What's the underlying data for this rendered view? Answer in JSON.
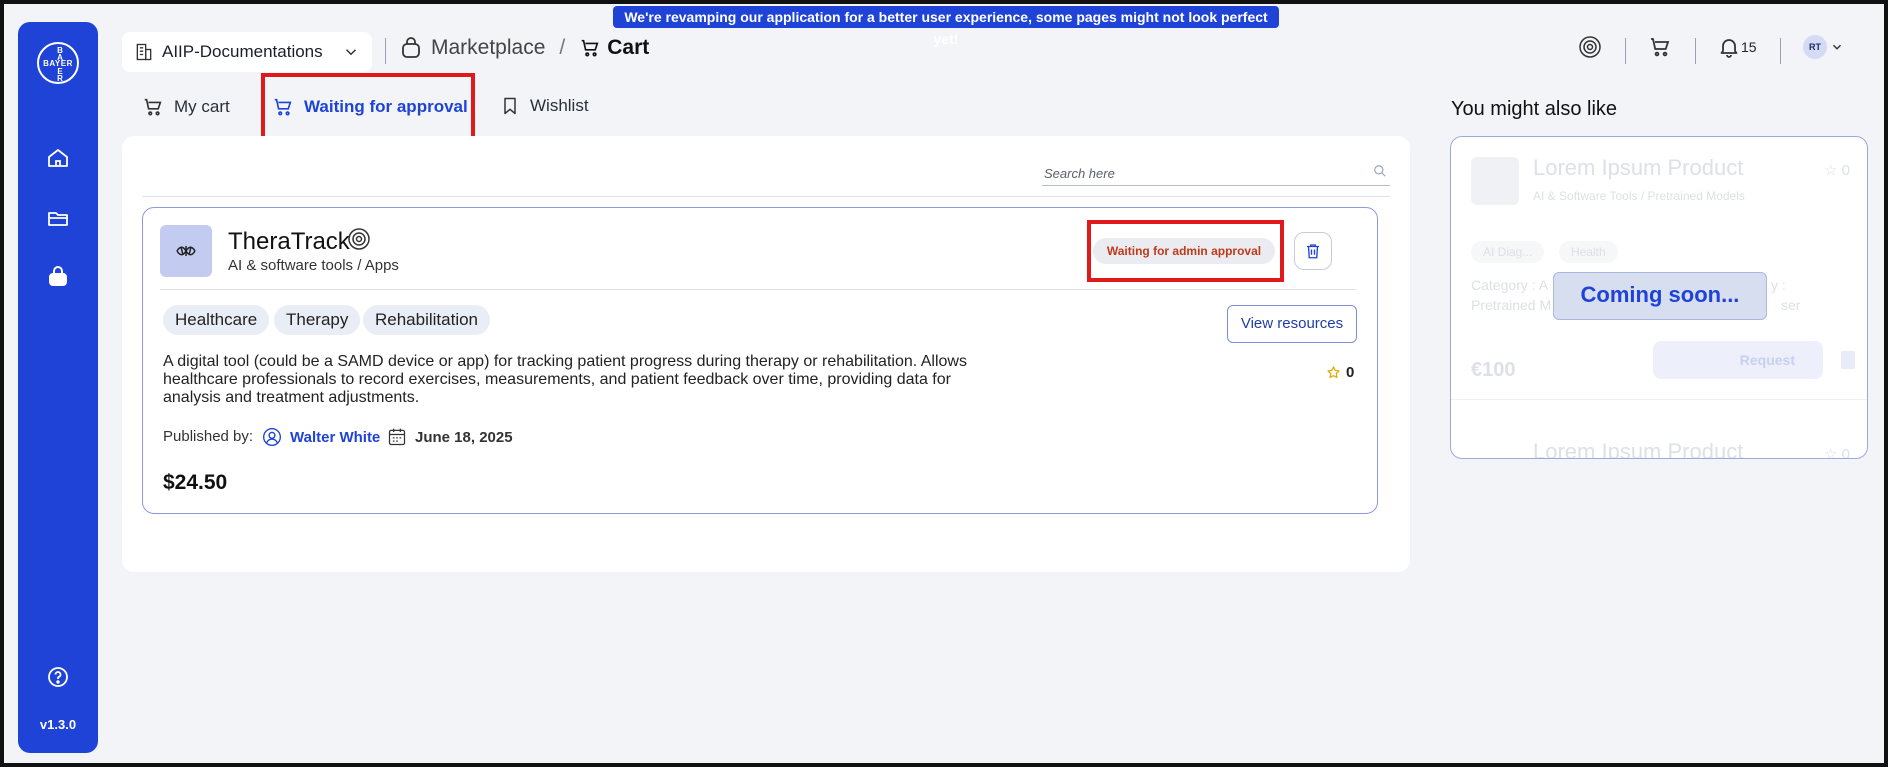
{
  "banner": {
    "text": "We're revamping our application for a better user experience, some pages might not look perfect yet!"
  },
  "sidebar": {
    "logo_horizontal": "BAYER",
    "logo_vertical": [
      "B",
      "A",
      "",
      "E",
      "R"
    ],
    "items": [
      {
        "icon": "home-icon"
      },
      {
        "icon": "folder-icon"
      },
      {
        "icon": "marketplace-bag-icon"
      },
      {
        "icon": "help-icon"
      }
    ],
    "version": "v1.3.0"
  },
  "header": {
    "workspace": "AIIP-Documentations",
    "breadcrumb": [
      {
        "label": "Marketplace"
      },
      {
        "label": "Cart"
      }
    ],
    "breadcrumb_separator": "/",
    "notifications_count": "15",
    "avatar_initials": "RT"
  },
  "tabs": [
    {
      "label": "My cart",
      "icon": "cart-icon",
      "active": false
    },
    {
      "label": "Waiting for approval",
      "icon": "cart-icon",
      "active": true
    },
    {
      "label": "Wishlist",
      "icon": "bookmark-icon",
      "active": false
    }
  ],
  "search": {
    "placeholder": "Search here"
  },
  "product": {
    "name": "TheraTrack",
    "category": "AI & software tools / Apps",
    "status": "Waiting for admin approval",
    "tags": [
      "Healthcare",
      "Therapy",
      "Rehabilitation"
    ],
    "view_button": "View resources",
    "rating": "0",
    "description_lines": [
      "A digital tool (could be a SAMD device or app) for tracking patient progress during therapy or rehabilitation. Allows",
      "healthcare professionals to record exercises, measurements, and patient feedback over time, providing data for",
      "analysis and treatment adjustments."
    ],
    "published_by_label": "Published by:",
    "publisher": "Walter White",
    "published_date": "June 18, 2025",
    "price": "$24.50"
  },
  "recommendations": {
    "title": "You might also like",
    "coming_soon": "Coming soon...",
    "placeholder_card": {
      "title": "Lorem Ipsum Product",
      "category": "AI & Software Tools / Pretrained Models",
      "tags": [
        "AI Diag...",
        "Health"
      ],
      "category_line1": "Category : A",
      "category_line1_right": "y :",
      "category_line2": "Pretrained M",
      "category_line2_right": "ser",
      "rating": "0",
      "price": "€100",
      "request_label": "Request",
      "title2": "Lorem Ipsum Product",
      "rating2": "0"
    }
  },
  "colors": {
    "primary": "#1f43d6",
    "status_text": "#c03a1a",
    "highlight": "#e01a1a"
  }
}
